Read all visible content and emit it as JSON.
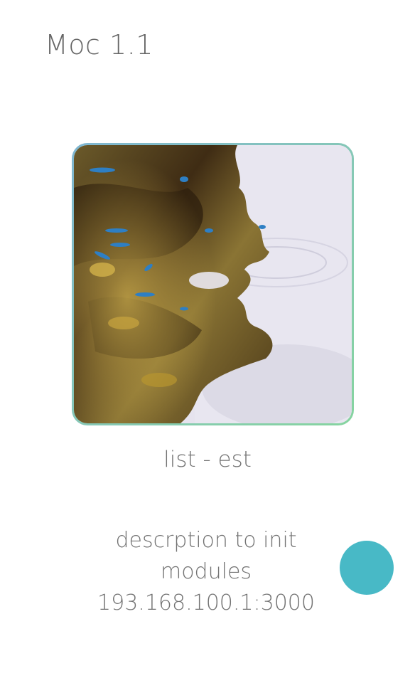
{
  "header": {
    "title": "Moc 1.1"
  },
  "main": {
    "image_name": "fish-in-shallow-water-photo",
    "list_label": "list - est",
    "description": {
      "line1": "descrption to init",
      "line2": "modules",
      "line3": "193.168.100.1:3000"
    }
  },
  "action": {
    "icon": "circle-action-button",
    "color": "#48b9c6"
  },
  "colors": {
    "frame_gradient_start": "#7fb6d1",
    "frame_gradient_end": "#86d4a0",
    "text": "#737373",
    "background": "#ffffff"
  }
}
